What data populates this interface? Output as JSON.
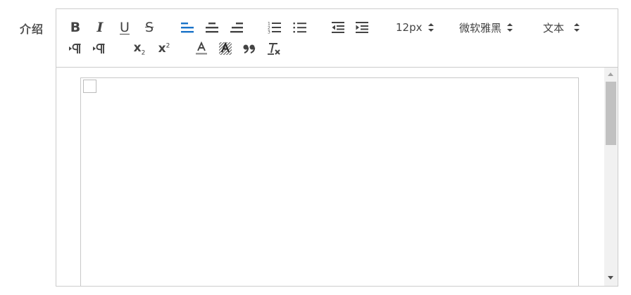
{
  "form": {
    "label": "介绍"
  },
  "toolbar": {
    "bold": "B",
    "italic": "I",
    "underline": "U",
    "strike": "S",
    "subscript_base": "x",
    "subscript_mark": "2",
    "superscript_base": "x",
    "superscript_mark": "2",
    "font_size": "12px",
    "font_family": "微软雅黑",
    "paragraph_format": "文本",
    "active_color": "#1a73c8",
    "icon_color": "#444444"
  },
  "icons": [
    "bold-icon",
    "italic-icon",
    "underline-icon",
    "strikethrough-icon",
    "align-left-icon",
    "align-center-icon",
    "align-right-icon",
    "ordered-list-icon",
    "bullet-list-icon",
    "outdent-icon",
    "indent-icon",
    "ltr-direction-icon",
    "rtl-direction-icon",
    "subscript-icon",
    "superscript-icon",
    "font-color-icon",
    "highlight-icon",
    "blockquote-icon",
    "clear-format-icon"
  ]
}
